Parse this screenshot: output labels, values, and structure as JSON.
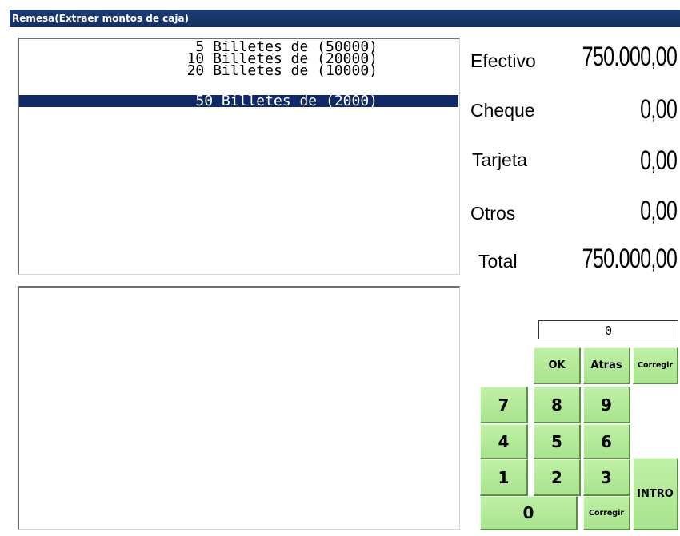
{
  "window": {
    "title": "Remesa(Extraer montos de caja)"
  },
  "denominations": [
    {
      "text": "5 Billetes de (50000)",
      "selected": false
    },
    {
      "text": "10 Billetes de (20000)",
      "selected": false
    },
    {
      "text": "20 Billetes de (10000)",
      "selected": false
    },
    {
      "text": "50 Billetes de (2000)",
      "selected": true
    }
  ],
  "summary": {
    "efectivo": {
      "label": "Efectivo",
      "value": "750.000,00"
    },
    "cheque": {
      "label": "Cheque",
      "value": "0,00"
    },
    "tarjeta": {
      "label": "Tarjeta",
      "value": "0,00"
    },
    "otros": {
      "label": "Otros",
      "value": "0,00"
    },
    "total": {
      "label": "Total",
      "value": "750.000,00"
    }
  },
  "keypad": {
    "display": "0",
    "ok": "OK",
    "atras": "Atras",
    "corregir_top": "Corregir",
    "corregir_bottom": "Corregir",
    "intro": "INTRO",
    "k7": "7",
    "k8": "8",
    "k9": "9",
    "k4": "4",
    "k5": "5",
    "k6": "6",
    "k1": "1",
    "k2": "2",
    "k3": "3",
    "k0": "0"
  }
}
